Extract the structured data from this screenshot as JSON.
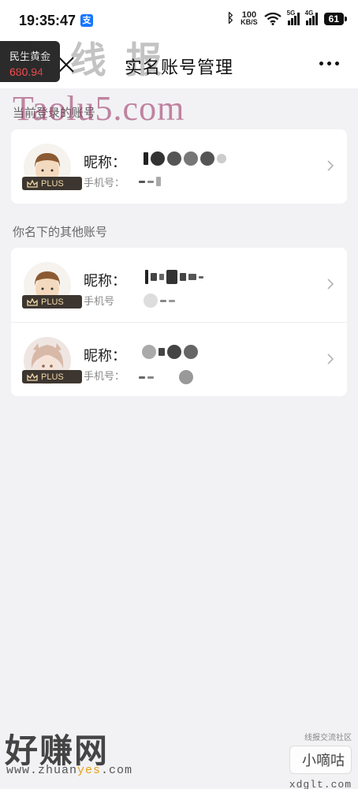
{
  "status_bar": {
    "time": "19:35:47",
    "app_icon_label": "支",
    "speed_value": "100",
    "speed_unit": "KB/S",
    "signal_5g": "5G",
    "signal_4g": "4G",
    "battery": "61"
  },
  "floating_badge": {
    "name": "民生黄金",
    "price": "680.94"
  },
  "nav": {
    "title": "实名账号管理"
  },
  "sections": {
    "current_label": "当前登录的账号",
    "others_label": "你名下的其他账号"
  },
  "current_account": {
    "nickname_label": "昵称：",
    "phone_label": "手机号：",
    "badge": "PLUS"
  },
  "other_accounts": [
    {
      "nickname_label": "昵称：",
      "phone_label": "手机号",
      "badge": "PLUS"
    },
    {
      "nickname_label": "昵称：",
      "phone_label": "手机号：",
      "badge": "PLUS"
    }
  ],
  "watermarks": {
    "top": "淘 线 报",
    "taolu": "Taolu5.com",
    "bottom_left": "好赚网",
    "bottom_url_prefix": "www.zhuan",
    "bottom_url_highlight": "yes",
    "bottom_url_suffix": ".com",
    "community": "线报交流社区",
    "brand": "小嘀咕",
    "domain": "xdglt.com"
  },
  "colors": {
    "price": "#ff4d4f",
    "plus_badge_bg": "#3d3630",
    "plus_badge_text": "#f2d8a8",
    "page_bg": "#f2f2f5"
  }
}
